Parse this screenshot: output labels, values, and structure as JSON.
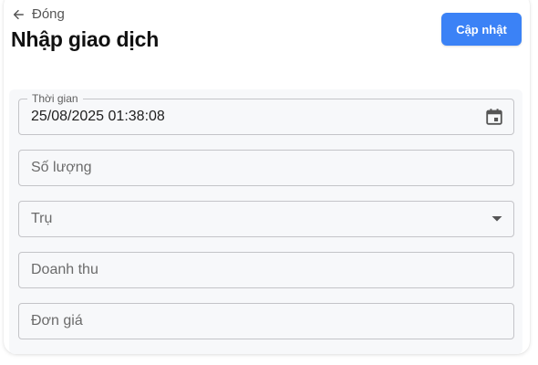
{
  "header": {
    "back_label": "Đóng",
    "title": "Nhập giao dịch",
    "update_label": "Cập nhật"
  },
  "form": {
    "time": {
      "label": "Thời gian",
      "value": "25/08/2025 01:38:08"
    },
    "quantity": {
      "placeholder": "Số lượng"
    },
    "pump": {
      "placeholder": "Trụ"
    },
    "revenue": {
      "placeholder": "Doanh thu"
    },
    "unit_price": {
      "placeholder": "Đơn giá"
    }
  },
  "colors": {
    "accent": "#3b82f6",
    "form_background": "#f7f8fa",
    "field_border": "#c4c4c8"
  },
  "icons": {
    "back": "arrow-left-icon",
    "calendar": "calendar-icon",
    "dropdown": "caret-down-icon"
  }
}
